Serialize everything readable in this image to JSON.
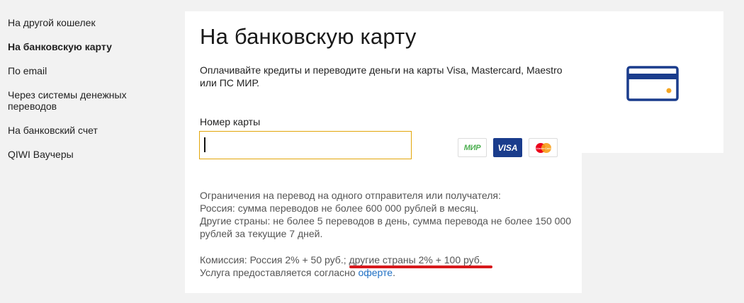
{
  "sidebar": {
    "items": [
      {
        "label": "На другой кошелек",
        "active": false
      },
      {
        "label": "На банковскую карту",
        "active": true
      },
      {
        "label": "По email",
        "active": false
      },
      {
        "label": "Через системы денежных переводов",
        "active": false
      },
      {
        "label": "На банковский счет",
        "active": false
      },
      {
        "label": "QIWI Ваучеры",
        "active": false
      }
    ]
  },
  "main": {
    "title": "На банковскую карту",
    "description": "Оплачивайте кредиты и переводите деньги на карты Visa, Mastercard, Maestro или ПС МИР.",
    "card_number": {
      "label": "Номер карты",
      "value": ""
    },
    "payment_logos": [
      {
        "name": "mir-logo",
        "label": "МИР"
      },
      {
        "name": "visa-logo",
        "label": "VISA"
      },
      {
        "name": "mastercard-logo",
        "label": "MasterCard"
      }
    ],
    "limits": {
      "line1": "Ограничения на перевод на одного отправителя или получателя:",
      "line2": "Россия: сумма переводов не более 600 000 рублей в месяц.",
      "line3": "Другие страны: не более 5 переводов в день, сумма перевода не более 150 000 рублей за текущие 7 дней."
    },
    "commission": {
      "prefix": "Комиссия: Россия 2% + 50 руб.; ",
      "highlight": "другие страны 2% + 100 руб.",
      "service_text": "Услуга предоставляется согласно ",
      "offer_link": "оферте",
      "service_end": "."
    }
  },
  "colors": {
    "background": "#f2f2f2",
    "card": "#ffffff",
    "input_border": "#e3a60a",
    "illustration": "#1a3c8c",
    "illustration_dot": "#f5a623",
    "link": "#1e6fc4",
    "underline_mark": "#d7191c",
    "mir_green": "#4caf50",
    "visa_blue": "#1a3c8c",
    "mc_red": "#eb001b",
    "mc_orange": "#f79e1b"
  }
}
